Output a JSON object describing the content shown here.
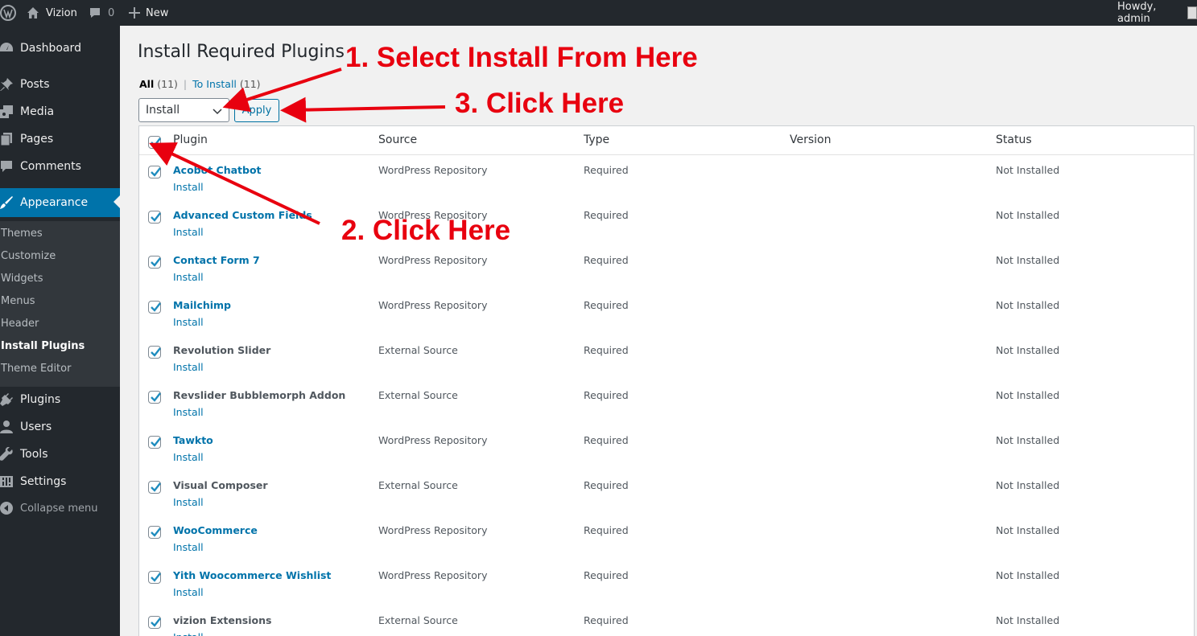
{
  "adminbar": {
    "site_name": "Vizion",
    "comment_count": "0",
    "new_label": "New",
    "howdy": "Howdy, admin"
  },
  "sidebar": {
    "items": [
      {
        "label": "Dashboard",
        "icon": "dashboard-icon"
      },
      {
        "label": "Posts",
        "icon": "pin-icon"
      },
      {
        "label": "Media",
        "icon": "media-icon"
      },
      {
        "label": "Pages",
        "icon": "pages-icon"
      },
      {
        "label": "Comments",
        "icon": "comment-icon"
      },
      {
        "label": "Appearance",
        "icon": "paintbrush-icon"
      },
      {
        "label": "Plugins",
        "icon": "plugin-icon"
      },
      {
        "label": "Users",
        "icon": "users-icon"
      },
      {
        "label": "Tools",
        "icon": "wrench-icon"
      },
      {
        "label": "Settings",
        "icon": "settings-icon"
      },
      {
        "label": "Collapse menu",
        "icon": "collapse-icon"
      }
    ],
    "submenu": [
      "Themes",
      "Customize",
      "Widgets",
      "Menus",
      "Header",
      "Install Plugins",
      "Theme Editor"
    ]
  },
  "main": {
    "title": "Install Required Plugins",
    "filters": {
      "all_label": "All",
      "all_count": "(11)",
      "separator": "|",
      "to_install_label": "To Install",
      "to_install_count": "(11)"
    },
    "bulk_select_value": "Install",
    "apply_label": "Apply",
    "columns": [
      "Plugin",
      "Source",
      "Type",
      "Version",
      "Status"
    ],
    "row_action": "Install",
    "rows": [
      {
        "name": "Acobot Chatbot",
        "source": "WordPress Repository",
        "type": "Required",
        "version": "",
        "status": "Not Installed"
      },
      {
        "name": "Advanced Custom Fields",
        "source": "WordPress Repository",
        "type": "Required",
        "version": "",
        "status": "Not Installed"
      },
      {
        "name": "Contact Form 7",
        "source": "WordPress Repository",
        "type": "Required",
        "version": "",
        "status": "Not Installed"
      },
      {
        "name": "Mailchimp",
        "source": "WordPress Repository",
        "type": "Required",
        "version": "",
        "status": "Not Installed"
      },
      {
        "name": "Revolution Slider",
        "source": "External Source",
        "type": "Required",
        "version": "",
        "status": "Not Installed"
      },
      {
        "name": "Revslider Bubblemorph Addon",
        "source": "External Source",
        "type": "Required",
        "version": "",
        "status": "Not Installed"
      },
      {
        "name": "Tawkto",
        "source": "WordPress Repository",
        "type": "Required",
        "version": "",
        "status": "Not Installed"
      },
      {
        "name": "Visual Composer",
        "source": "External Source",
        "type": "Required",
        "version": "",
        "status": "Not Installed"
      },
      {
        "name": "WooCommerce",
        "source": "WordPress Repository",
        "type": "Required",
        "version": "",
        "status": "Not Installed"
      },
      {
        "name": "Yith Woocommerce Wishlist",
        "source": "WordPress Repository",
        "type": "Required",
        "version": "",
        "status": "Not Installed"
      },
      {
        "name": "vizion Extensions",
        "source": "External Source",
        "type": "Required",
        "version": "",
        "status": "Not Installed"
      }
    ]
  },
  "annotations": {
    "step1": "1. Select Install From Here",
    "step2": "2. Click Here",
    "step3": "3. Click Here",
    "color": "#e8000f"
  },
  "colors": {
    "adminbar_bg": "#23282d",
    "menu_current": "#0073aa",
    "link": "#0073aa"
  }
}
